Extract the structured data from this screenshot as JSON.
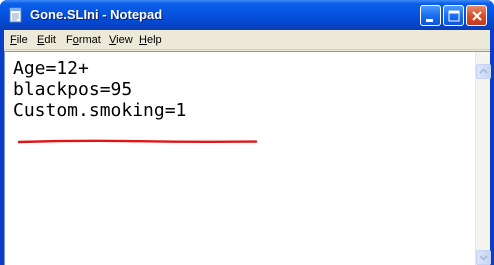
{
  "window": {
    "title": "Gone.SLIni - Notepad",
    "title_color": "#ffffff",
    "titlebar_color": "#0553df"
  },
  "menu": {
    "items": [
      {
        "accel": "F",
        "rest": "ile"
      },
      {
        "accel": "E",
        "rest": "dit"
      },
      {
        "pre": "F",
        "accel": "o",
        "rest": "rmat"
      },
      {
        "accel": "V",
        "rest": "iew"
      },
      {
        "accel": "H",
        "rest": "elp"
      }
    ]
  },
  "document": {
    "lines": [
      "Age=12+",
      "blackpos=95",
      "Custom.smoking=1"
    ],
    "highlight_color": "#e01515"
  },
  "icons": {
    "app": "notepad-icon",
    "minimize": "minimize-icon",
    "maximize": "maximize-icon",
    "close": "close-icon",
    "scroll_up": "scroll-up-arrow-icon",
    "scroll_down": "scroll-down-arrow-icon"
  }
}
